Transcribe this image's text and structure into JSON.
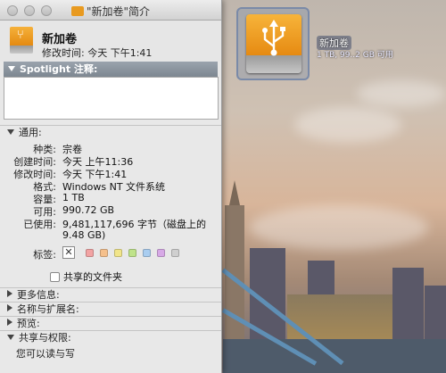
{
  "window": {
    "title": "\"新加卷\"简介",
    "header_name": "新加卷",
    "header_modified": "修改时间:  今天 下午1:41"
  },
  "spotlight": {
    "header": "Spotlight 注释:",
    "comment_value": ""
  },
  "general": {
    "header": "通用:",
    "rows": [
      {
        "label": "种类:",
        "value": "宗卷"
      },
      {
        "label": "创建时间:",
        "value": "今天 上午11:36"
      },
      {
        "label": "修改时间:",
        "value": "今天 下午1:41"
      },
      {
        "label": "格式:",
        "value": "Windows NT 文件系统"
      },
      {
        "label": "容量:",
        "value": "1 TB"
      },
      {
        "label": "可用:",
        "value": "990.72 GB"
      },
      {
        "label": "已使用:",
        "value": "9,481,117,696 字节（磁盘上的"
      },
      {
        "label": "",
        "value": "9.48 GB)"
      }
    ],
    "tags_label": "标签:",
    "tag_clear_glyph": "✕",
    "tag_colors": [
      "#f2a3a3",
      "#f5c08c",
      "#f1e58a",
      "#bfe38a",
      "#a9cdf0",
      "#d7a9e6",
      "#cfcfcf"
    ],
    "shared_label": "共享的文件夹"
  },
  "sections": [
    {
      "label": "更多信息:"
    },
    {
      "label": "名称与扩展名:"
    },
    {
      "label": "预览:"
    }
  ],
  "permissions": {
    "header": "共享与权限:",
    "text": "您可以读与写"
  },
  "desktop": {
    "drive_label": "新加卷",
    "drive_sub": "1 TB, 99..2 GB 可用",
    "icon": "usb-drive-icon"
  },
  "colors": {
    "drive_orange": "#e8941c",
    "window_bg": "#e8e8e8",
    "spotlight_header": "#8a939d"
  }
}
